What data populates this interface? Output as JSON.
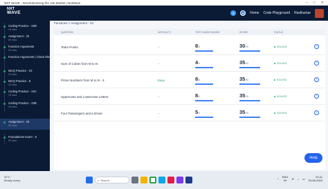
{
  "window": {
    "title": "NXT WAVE - Revolutionizing the Job Market | NxtWave"
  },
  "brand": {
    "line1": "NXT",
    "line2": "WAVE"
  },
  "topnav": {
    "streak_count": "0",
    "coins": "48",
    "links": [
      "Home",
      "Code Playground",
      "Ravikumar"
    ]
  },
  "sidebar": {
    "items": [
      {
        "title": "Coding Practice - 22B",
        "meta": "15 mins"
      },
      {
        "title": "Assignment - 22",
        "meta": "60 mins"
      },
      {
        "title": "Function Arguments",
        "meta": "25 mins"
      },
      {
        "title": "Function Arguments | Cheat Sheet",
        "meta": ""
      },
      {
        "title": "MCQ Practice - 23",
        "meta": "20 mins"
      },
      {
        "title": "MCQ Practice - 8",
        "meta": "15 mins"
      },
      {
        "title": "Coding Practice - 23A",
        "meta": "15 mins"
      },
      {
        "title": "Coding Practice - 23B",
        "meta": "15 mins"
      },
      {
        "title": "Assignment - 23",
        "meta": "60 mins"
      },
      {
        "title": "Foundations Exam - 5",
        "meta": "90 mins"
      }
    ]
  },
  "breadcrumb": "Functions > Assignment - 23",
  "table": {
    "headers": [
      "QUESTION",
      "DIFFICULTY",
      "TEST CASES PASSED",
      "SCORE",
      "STATUS"
    ],
    "rows": [
      {
        "question": "Team Points",
        "difficulty": "--",
        "passed": "8",
        "passed_total": "/8",
        "score": "30",
        "score_total": "/30",
        "status": "SOLVED"
      },
      {
        "question": "Sum of Cubes from M to N",
        "difficulty": "--",
        "passed": "4",
        "passed_total": "/4",
        "score": "35",
        "score_total": "/35",
        "status": "SOLVED"
      },
      {
        "question": "Prime Numbers from M to N - 3",
        "difficulty": "Easy",
        "passed": "8",
        "passed_total": "/8",
        "score": "35",
        "score_total": "/35",
        "status": "SOLVED"
      },
      {
        "question": "Uppercase and Lowercase Letters",
        "difficulty": "--",
        "passed": "8",
        "passed_total": "/8",
        "score": "35",
        "score_total": "/35",
        "status": "SOLVED"
      },
      {
        "question": "Four Passengers and a Driver",
        "difficulty": "--",
        "passed": "5",
        "passed_total": "/5",
        "score": "35",
        "score_total": "/35",
        "status": "SOLVED"
      }
    ]
  },
  "help_label": "Help",
  "taskbar": {
    "weather_temp": "32°C",
    "weather_desc": "Mostly sunny",
    "search_placeholder": "Search",
    "lang": "ENG",
    "region": "IN",
    "time": "21:41",
    "date": "20-06-2023"
  },
  "colors": {
    "nav_bg": "#0b1b35",
    "accent": "#2563eb",
    "solved": "#2aa06b"
  }
}
